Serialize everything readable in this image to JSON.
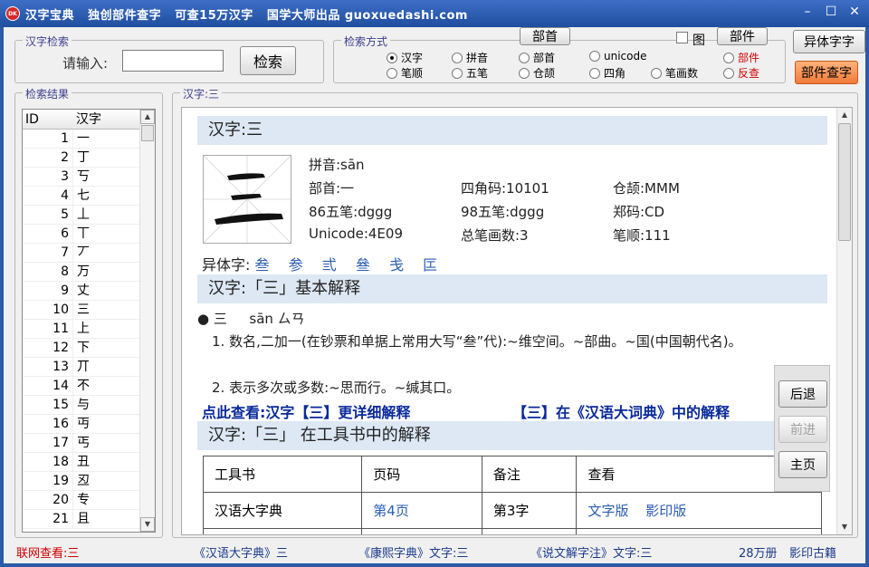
{
  "window": {
    "title": "汉字宝典   独创部件查字   可查15万汉字   国学大师出品 guoxuedashi.com",
    "app_icon_text": "DK"
  },
  "search_group": {
    "label": "汉字检索",
    "input_label": "请输入:",
    "input_value": "",
    "search_button": "检索"
  },
  "mode_group": {
    "label": "检索方式",
    "bushou_button": "部首",
    "bujian_button": "部件",
    "tu_checkbox_label": "图",
    "options_row1": [
      "汉字",
      "拼音",
      "部首",
      "unicode",
      "部件"
    ],
    "options_row2": [
      "笔顺",
      "五笔",
      "仓颉",
      "四角",
      "笔画数",
      "反查"
    ],
    "selected": "汉字"
  },
  "right_buttons": {
    "variant_button": "异体字字",
    "bujian_lookup_button": "部件查字"
  },
  "results": {
    "label": "检索结果",
    "columns": [
      "ID",
      "汉字"
    ],
    "rows": [
      [
        "1",
        "一"
      ],
      [
        "2",
        "丁"
      ],
      [
        "3",
        "丂"
      ],
      [
        "4",
        "七"
      ],
      [
        "5",
        "丄"
      ],
      [
        "6",
        "丅"
      ],
      [
        "7",
        "丆"
      ],
      [
        "8",
        "万"
      ],
      [
        "9",
        "丈"
      ],
      [
        "10",
        "三"
      ],
      [
        "11",
        "上"
      ],
      [
        "12",
        "下"
      ],
      [
        "13",
        "丌"
      ],
      [
        "14",
        "不"
      ],
      [
        "15",
        "与"
      ],
      [
        "16",
        "丏"
      ],
      [
        "17",
        "丐"
      ],
      [
        "18",
        "丑"
      ],
      [
        "19",
        "丒"
      ],
      [
        "20",
        "专"
      ],
      [
        "21",
        "且"
      ]
    ]
  },
  "detail": {
    "label": "汉字:三",
    "head1": "汉字:三",
    "stroke_image_alt": "三",
    "pinyin": "拼音:sān",
    "bushou": "部首:一",
    "sijiao": "四角码:10101",
    "cangjie": "仓颉:MMM",
    "wubi86": "86五笔:dggg",
    "wubi98": "98五笔:dggg",
    "zhengma": "郑码:CD",
    "unicode": "Unicode:4E09",
    "strokes": "总笔画数:3",
    "bishun": "笔顺:111",
    "variants_label": "异体字:",
    "variants": [
      "叁",
      "参",
      "弎",
      "叄",
      "戋",
      "匞"
    ],
    "head2": "汉字:「三」基本解释",
    "entry_line": "● 三　  sān ㄙㄢ",
    "def1": "1. 数名,二加一(在钞票和单据上常用大写“叁”代):~维空间。~部曲。~国(中国朝代名)。",
    "def2": "2. 表示多次或多数:~思而行。~缄其口。",
    "more_link": "点此查看:汉字【三】更详细解释",
    "dict_link": "【三】在《汉语大词典》中的解释",
    "head3": "汉字:「三」 在工具书中的解释",
    "table_headers": [
      "工具书",
      "页码",
      "备注",
      "查看"
    ],
    "table_row": {
      "book": "汉语大字典",
      "page": "第4页",
      "note": "第3字",
      "view_text": "文字版",
      "view_image": "影印版"
    }
  },
  "nav": {
    "back": "后退",
    "forward": "前进",
    "home": "主页"
  },
  "status": {
    "online": "联网查看:三",
    "hydzd": "《汉语大字典》三",
    "kangxi": "《康熙字典》文字:三",
    "shuowen": "《说文解字注》文字:三",
    "books": "28万册",
    "guji": "影印古籍"
  }
}
